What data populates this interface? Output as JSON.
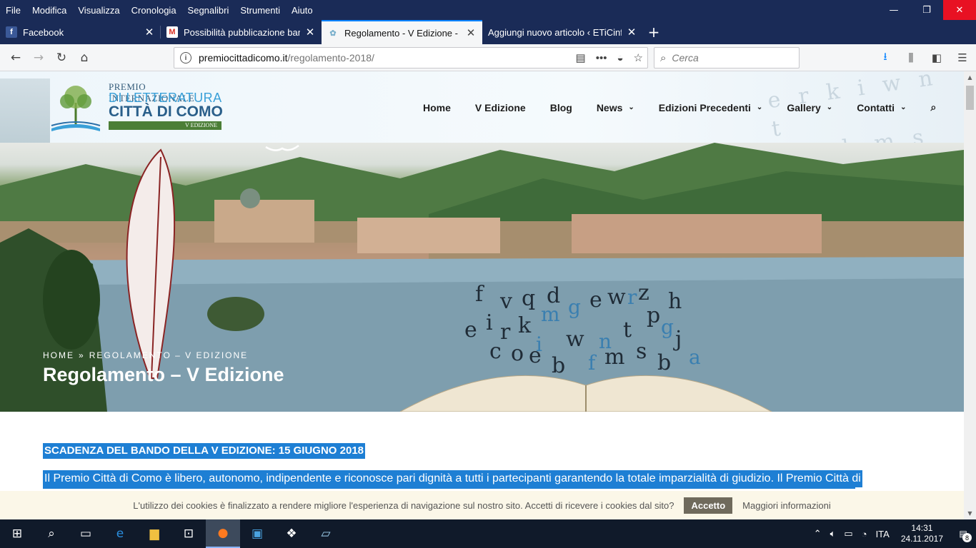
{
  "menubar": {
    "items": [
      "File",
      "Modifica",
      "Visualizza",
      "Cronologia",
      "Segnalibri",
      "Strumenti",
      "Aiuto"
    ]
  },
  "window_controls": {
    "minimize": "—",
    "restore": "❐",
    "close": "✕"
  },
  "tabs": [
    {
      "title": "Facebook",
      "favicon": "f",
      "favicon_color": "#3b5998",
      "active": false
    },
    {
      "title": "Possibilità pubblicazione bando",
      "favicon": "M",
      "favicon_color": "#d93025",
      "active": false
    },
    {
      "title": "Regolamento - V Edizione - Pre",
      "favicon": "✿",
      "favicon_color": "#7ab0cc",
      "active": true
    },
    {
      "title": "Aggiungi nuovo articolo ‹ ETiCinfo",
      "favicon": "",
      "favicon_color": "#1a2b57",
      "active": false
    }
  ],
  "newtab_label": "+",
  "navbar": {
    "url_host": "premiocittadicomo.it",
    "url_path": "/regolamento-2018/",
    "search_placeholder": "Cerca"
  },
  "site": {
    "logo": {
      "line1": "PREMIO INTERNAZIONALE",
      "line2": "DI LETTERATURA",
      "line3": "CITTÀ DI COMO",
      "line4": "V EDIZIONE"
    },
    "nav": [
      {
        "label": "Home",
        "dropdown": false
      },
      {
        "label": "V Edizione",
        "dropdown": false
      },
      {
        "label": "Blog",
        "dropdown": false
      },
      {
        "label": "News",
        "dropdown": true
      },
      {
        "label": "Edizioni Precedenti",
        "dropdown": true
      },
      {
        "label": "Gallery",
        "dropdown": true
      },
      {
        "label": "Contatti",
        "dropdown": true
      }
    ],
    "breadcrumb": {
      "home": "HOME",
      "sep": "»",
      "current": "REGOLAMENTO – V EDIZIONE"
    },
    "page_title": "Regolamento – V Edizione",
    "hero_letters": "fvqd ewz h e i r k w n t p g j c o e b f m s b a",
    "content": {
      "deadline": "SCADENZA DEL BANDO DELLA V EDIZIONE: 15 GIUGNO 2018",
      "paragraph": "Il Premio Città di Como è libero, autonomo, indipendente e riconosce pari dignità a tutti i partecipanti garantendo la totale imparzialità di giudizio. Il Premio Città di"
    },
    "cookie": {
      "text": "L'utilizzo dei cookies è finalizzato a rendere migliore l'esperienza di navigazione sul nostro sito. Accetti di ricevere i cookies dal sito?",
      "accept": "Accetto",
      "more": "Maggiori informazioni"
    }
  },
  "taskbar": {
    "tray_lang": "ITA",
    "time": "14:31",
    "date": "24.11.2017",
    "notifications": "8"
  },
  "colors": {
    "browser_chrome": "#1a2b57",
    "selection": "#1e7fd4",
    "close_button": "#e81123"
  }
}
